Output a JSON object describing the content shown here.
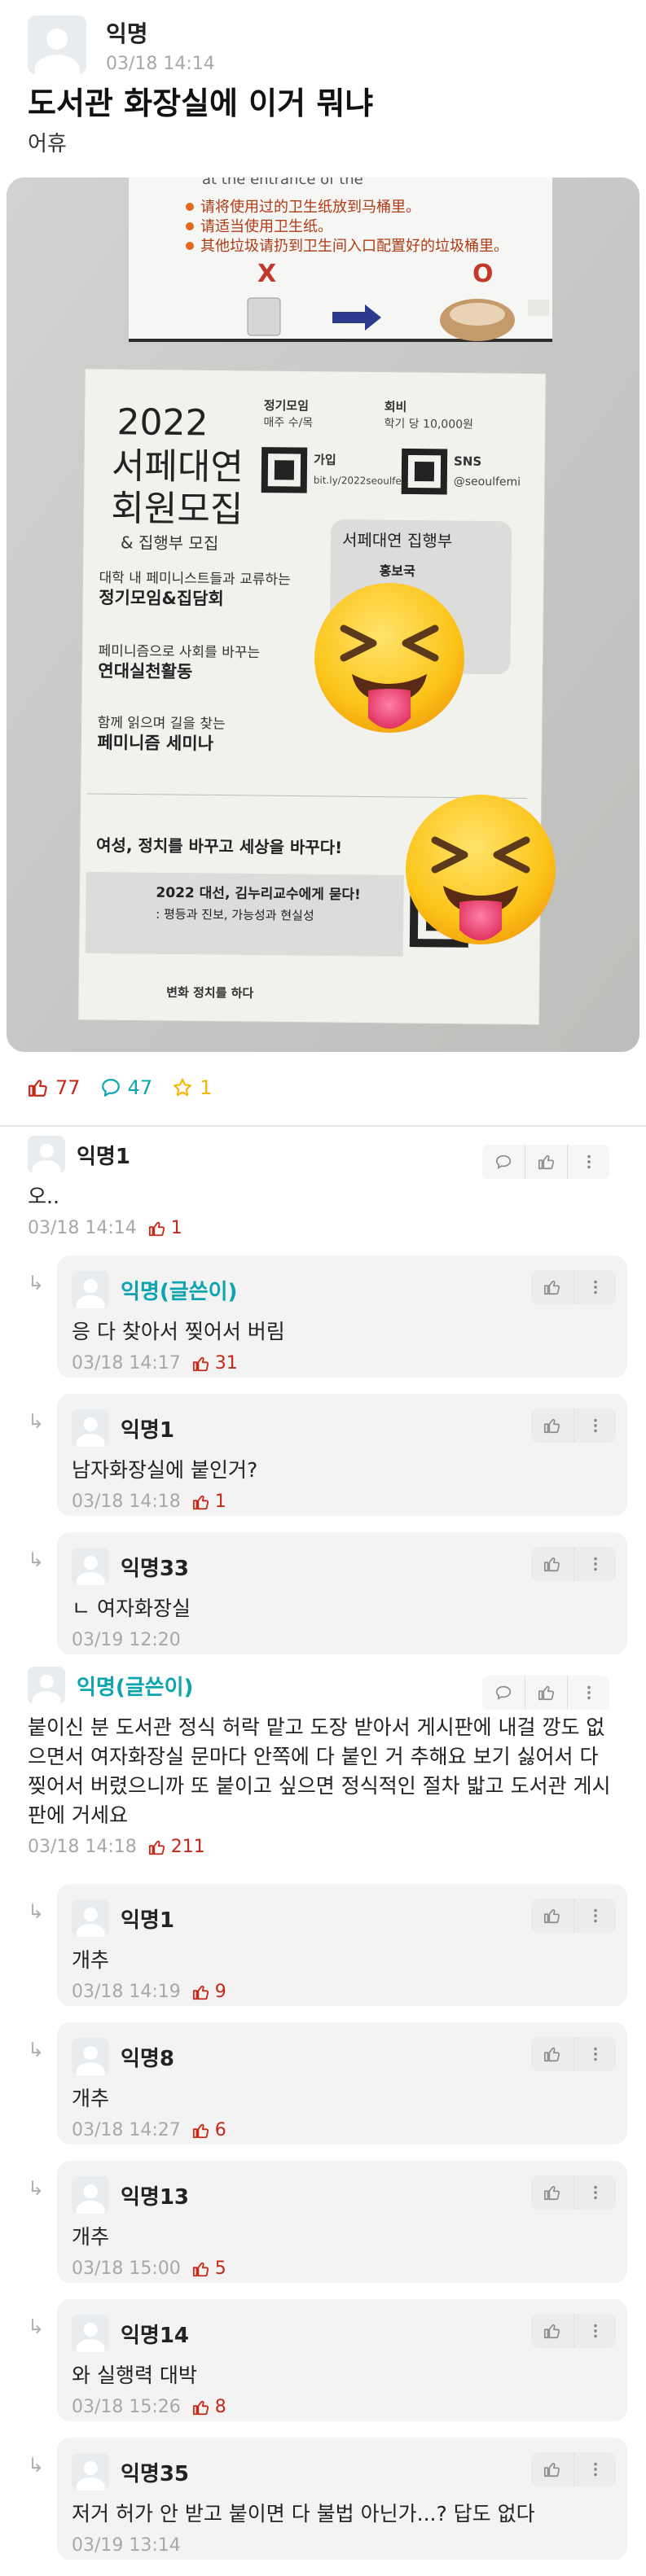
{
  "post": {
    "author": "익명",
    "time": "03/18 14:14",
    "title": "도서관 화장실에 이거 뭐냐",
    "body": "어휴",
    "photo": {
      "poster_year": "2022",
      "poster_title_1": "서페대연",
      "poster_title_2": "회원모집",
      "poster_sub": "& 집행부 모집",
      "sign_lines": [
        "请将使用过的卫生纸放到马桶里。",
        "请适当使用卫生纸。",
        "其他垃圾请扔到卫生间入口配置好的垃圾桶里。"
      ],
      "poster_meeting_label": "정기모임",
      "poster_meeting_value": "매주 수/목",
      "poster_fee_label": "회비",
      "poster_fee_value": "학기 당 10,000원",
      "poster_join": "가입",
      "poster_link": "bit.ly/2022seoulfemi",
      "poster_sns": "SNS",
      "poster_handle": "@seoulfemi",
      "poster_box_title": "서페대연 집행부",
      "poster_box_item": "홍보국",
      "poster_line_1": "대학 내 페미니스트들과 교류하는",
      "poster_line_2": "정기모임&집담회",
      "poster_line_3": "페미니즘으로 사회를 바꾸는",
      "poster_line_4": "연대실천활동",
      "poster_line_5": "함께 읽으며 길을 찾는",
      "poster_line_6": "페미니즘 세미나",
      "poster_slogan_1": "여성, 정치를 바꾸고 세상을 바꾸다!",
      "poster_event": "2022 대선, 김누리교수에게 묻다!",
      "poster_event_sub": ": 평등과 진보, 가능성과 현실성",
      "poster_lecture": "변화 정치를 하다"
    }
  },
  "stats": {
    "likes": "77",
    "comments": "47",
    "scraps": "1"
  },
  "comments": [
    {
      "type": "top",
      "author": "익명1",
      "op": false,
      "body": "오..",
      "time": "03/18 14:14",
      "likes": "1",
      "actions": [
        "reply",
        "like",
        "more"
      ]
    },
    {
      "type": "reply",
      "author": "익명(글쓴이)",
      "op": true,
      "body": "응 다 찾아서 찢어서 버림",
      "time": "03/18 14:17",
      "likes": "31",
      "actions": [
        "like",
        "more"
      ]
    },
    {
      "type": "reply",
      "author": "익명1",
      "op": false,
      "body": "남자화장실에 붙인거?",
      "time": "03/18 14:18",
      "likes": "1",
      "actions": [
        "like",
        "more"
      ]
    },
    {
      "type": "reply",
      "author": "익명33",
      "op": false,
      "body": "ㄴ 여자화장실",
      "time": "03/19 12:20",
      "likes": "",
      "actions": [
        "like",
        "more"
      ]
    },
    {
      "type": "top",
      "author": "익명(글쓴이)",
      "op": true,
      "body": "붙이신 분 도서관 정식 허락 맡고 도장 받아서 게시판에 내걸 깡도 없으면서 여자화장실 문마다 안쪽에 다 붙인 거 추해요 보기 싫어서 다 찢어서 버렸으니까 또 붙이고 싶으면 정식적인 절차 밟고 도서관 게시판에 거세요",
      "time": "03/18 14:18",
      "likes": "211",
      "actions": [
        "reply",
        "like",
        "more"
      ]
    },
    {
      "type": "reply",
      "author": "익명1",
      "op": false,
      "body": "개추",
      "time": "03/18 14:19",
      "likes": "9",
      "actions": [
        "like",
        "more"
      ]
    },
    {
      "type": "reply",
      "author": "익명8",
      "op": false,
      "body": "개추",
      "time": "03/18 14:27",
      "likes": "6",
      "actions": [
        "like",
        "more"
      ]
    },
    {
      "type": "reply",
      "author": "익명13",
      "op": false,
      "body": "개추",
      "time": "03/18 15:00",
      "likes": "5",
      "actions": [
        "like",
        "more"
      ]
    },
    {
      "type": "reply",
      "author": "익명14",
      "op": false,
      "body": "와 실행력 대박",
      "time": "03/18 15:26",
      "likes": "8",
      "actions": [
        "like",
        "more"
      ]
    },
    {
      "type": "reply",
      "author": "익명35",
      "op": false,
      "body": "저거 허가 안 받고 붙이면 다 불법 아닌가...? 답도 없다",
      "time": "03/19 13:14",
      "likes": "",
      "actions": [
        "like",
        "more"
      ]
    }
  ],
  "colors": {
    "like": "#c62917",
    "comment": "#0ca5af",
    "scrap": "#f2b705",
    "op": "#0ca5af",
    "card": "#f3f3f3"
  }
}
